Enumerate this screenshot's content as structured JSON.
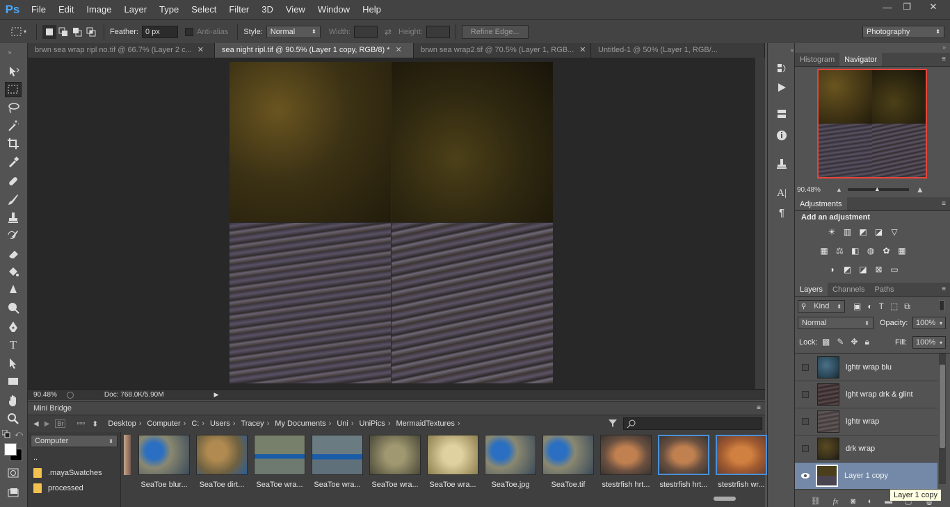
{
  "app": {
    "logo": "Ps"
  },
  "menu": [
    "File",
    "Edit",
    "Image",
    "Layer",
    "Type",
    "Select",
    "Filter",
    "3D",
    "View",
    "Window",
    "Help"
  ],
  "window_controls": {
    "minimize": "—",
    "restore": "❐",
    "close": "✕"
  },
  "options": {
    "feather_label": "Feather:",
    "feather_value": "0 px",
    "antialias_label": "Anti-alias",
    "style_label": "Style:",
    "style_value": "Normal",
    "width_label": "Width:",
    "height_label": "Height:",
    "refine_edge": "Refine Edge...",
    "workspace": "Photography"
  },
  "doc_tabs": [
    {
      "title": "brwn sea wrap ripl no.tif @ 66.7% (Layer 2 c...",
      "active": false
    },
    {
      "title": "sea night ripl.tif @ 90.5% (Layer 1 copy, RGB/8) *",
      "active": true
    },
    {
      "title": "brwn sea wrap2.tif @ 70.5% (Layer 1, RGB...",
      "active": false
    },
    {
      "title": "Untitled-1 @ 50% (Layer 1, RGB/...",
      "active": false
    }
  ],
  "status": {
    "zoom": "90.48%",
    "doc": "Doc: 768.0K/5.90M"
  },
  "mini_bridge": {
    "title": "Mini Bridge",
    "breadcrumbs": [
      "Desktop",
      "Computer",
      "C:",
      "Users",
      "Tracey",
      "My Documents",
      "Uni",
      "UniPics",
      "MermaidTextures"
    ],
    "location": "Computer",
    "folders": [
      "..",
      ".mayaSwatches",
      "processed"
    ],
    "thumbnails": [
      {
        "label": "SeaToe blur...",
        "selected": false
      },
      {
        "label": "SeaToe dirt...",
        "selected": false
      },
      {
        "label": "SeaToe wra...",
        "selected": false
      },
      {
        "label": "SeaToe wra...",
        "selected": false
      },
      {
        "label": "SeaToe wra...",
        "selected": false
      },
      {
        "label": "SeaToe wra...",
        "selected": false
      },
      {
        "label": "SeaToe.jpg",
        "selected": false
      },
      {
        "label": "SeaToe.tif",
        "selected": false
      },
      {
        "label": "stestrfish hrt...",
        "selected": false
      },
      {
        "label": "stestrfish hrt...",
        "selected": true
      },
      {
        "label": "stestrfish wr...",
        "selected": false
      }
    ]
  },
  "panels": {
    "histogram_tab": "Histogram",
    "navigator_tab": "Navigator",
    "nav_zoom": "90.48%",
    "adjustments_tab": "Adjustments",
    "add_adjustment": "Add an adjustment",
    "layers_tab": "Layers",
    "channels_tab": "Channels",
    "paths_tab": "Paths",
    "kind_label": "Kind",
    "blend_mode": "Normal",
    "opacity_label": "Opacity:",
    "opacity_value": "100%",
    "lock_label": "Lock:",
    "fill_label": "Fill:",
    "fill_value": "100%"
  },
  "layers": [
    {
      "name": "lghtr wrap blu",
      "visible": false,
      "selected": false,
      "color": "#2c4a5a"
    },
    {
      "name": "lght wrap drk & glint",
      "visible": false,
      "selected": false,
      "color": "#3b2e2c"
    },
    {
      "name": "lghtr wrap",
      "visible": false,
      "selected": false,
      "color": "#4a4040"
    },
    {
      "name": "drk wrap",
      "visible": false,
      "selected": false,
      "color": "#3a321c"
    },
    {
      "name": "Layer 1 copy",
      "visible": true,
      "selected": true,
      "color": "#3c341e"
    }
  ],
  "tooltip": "Layer 1 copy"
}
